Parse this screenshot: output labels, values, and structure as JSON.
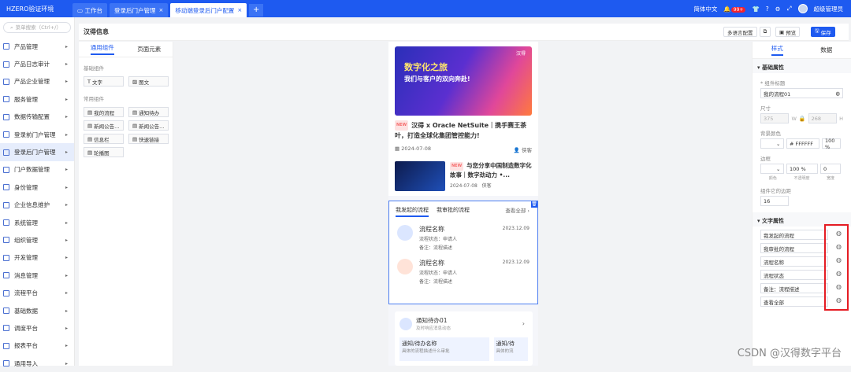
{
  "topbar": {
    "brand": "HZERO验证环境",
    "tabs": [
      {
        "label": "工作台",
        "closable": false
      },
      {
        "label": "登录后门户管理",
        "closable": true
      },
      {
        "label": "移动端登录后门户配置",
        "closable": true
      }
    ],
    "add": "+",
    "language": "简体中文",
    "notify_count": "99+",
    "user": "超级管理员"
  },
  "sidebar": {
    "search_placeholder": "菜单搜索（Ctrl+/）",
    "items": [
      "产品管理",
      "产品日志审计",
      "产品企业管理",
      "服务管理",
      "数据传输配置",
      "登录前门户管理",
      "登录后门户管理",
      "门户数据管理",
      "身份管理",
      "企业信息维护",
      "系统管理",
      "组织管理",
      "开发管理",
      "消息管理",
      "流程平台",
      "基础数据",
      "调度平台",
      "报表平台",
      "通用导入"
    ]
  },
  "page": {
    "title": "汉得信息",
    "btn_multi": "多语言配置",
    "btn_preview": "预览",
    "btn_save": "保存"
  },
  "left_panel": {
    "tab_common": "通用组件",
    "tab_page": "页面元素",
    "group_basic": "基础组件",
    "basic": [
      "文字",
      "图文"
    ],
    "group_common": "常用组件",
    "common": [
      "我的流程",
      "通知待办",
      "新闻公告...",
      "新闻公告...",
      "信息栏",
      "快速链接",
      "轮播图"
    ]
  },
  "phone": {
    "banner_title": "数字化之旅",
    "banner_sub": "我们与客户的双向奔赴!",
    "banner_logo": "汉得",
    "news1_tag": "NEW",
    "news1_title": "汉得 x Oracle NetSuite｜携手赛王茶叶，打造全球化集团管控能力!",
    "news1_date": "2024-07-08",
    "news1_author": "侠客",
    "news2_tag": "NEW",
    "news2_title": "与您分享中国制造数字化故事｜数字劲动力 •...",
    "news2_date": "2024-07-08",
    "news2_author": "侠客",
    "flow_tab1": "我发起的流程",
    "flow_tab2": "我审批的流程",
    "flow_more": "查看全部",
    "flows": [
      {
        "name": "流程名称",
        "status": "流程状态：申请人",
        "note": "备注：流程描述",
        "date": "2023.12.09"
      },
      {
        "name": "流程名称",
        "status": "流程状态：申请人",
        "note": "备注：流程描述",
        "date": "2023.12.09"
      }
    ],
    "notice_title": "通知待办01",
    "notice_sub": "及时响应消息动态",
    "notice_card1_title": "通知/待办名称",
    "notice_card1_sub": "具体的流程描述什么审批",
    "notice_card2_title": "通知/待",
    "notice_card2_sub": "具体的流"
  },
  "right_panel": {
    "tab_style": "样式",
    "tab_data": "数据",
    "basic_section": "基础属性",
    "comp_title_label": "* 组件标题",
    "comp_title_value": "我的流程01",
    "size_label": "尺寸",
    "width": "375",
    "w": "W",
    "height": "268",
    "h": "H",
    "bg_label": "背景颜色",
    "bg_color": "# FFFFFF",
    "bg_opacity": "100 %",
    "border_label": "边框",
    "border_opacity": "100 %",
    "border_width": "0",
    "caption_color": "颜色",
    "caption_opacity": "不透明度",
    "caption_width": "宽度",
    "radius_label": "组件它的边距",
    "radius_value": "16",
    "text_section": "文字属性",
    "text_items": [
      "我发起的流程",
      "我审批的流程",
      "流程名称",
      "流程状态",
      "备注：流程描述",
      "查看全部"
    ]
  },
  "watermark": "CSDN @汉得数字平台"
}
